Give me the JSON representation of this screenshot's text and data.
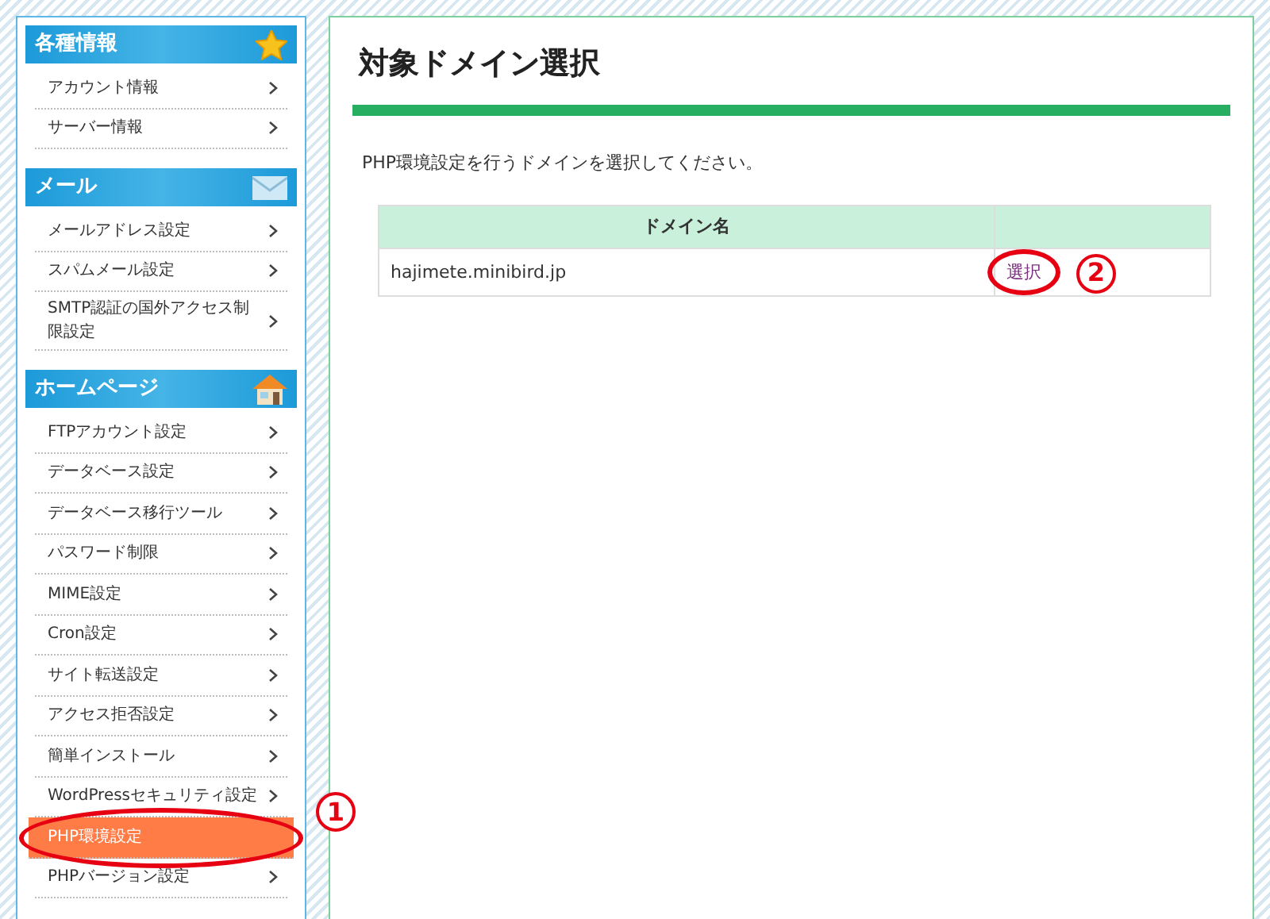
{
  "sidebar": {
    "sections": [
      {
        "title": "各種情報",
        "kind": "star",
        "items": [
          {
            "label": "アカウント情報",
            "selected": false
          },
          {
            "label": "サーバー情報",
            "selected": false
          }
        ]
      },
      {
        "title": "メール",
        "kind": "mail",
        "items": [
          {
            "label": "メールアドレス設定",
            "selected": false
          },
          {
            "label": "スパムメール設定",
            "selected": false
          },
          {
            "label": "SMTP認証の国外アクセス制限設定",
            "selected": false
          }
        ]
      },
      {
        "title": "ホームページ",
        "kind": "home",
        "items": [
          {
            "label": "FTPアカウント設定",
            "selected": false
          },
          {
            "label": "データベース設定",
            "selected": false
          },
          {
            "label": "データベース移行ツール",
            "selected": false
          },
          {
            "label": "パスワード制限",
            "selected": false
          },
          {
            "label": "MIME設定",
            "selected": false
          },
          {
            "label": "Cron設定",
            "selected": false
          },
          {
            "label": "サイト転送設定",
            "selected": false
          },
          {
            "label": "アクセス拒否設定",
            "selected": false
          },
          {
            "label": "簡単インストール",
            "selected": false
          },
          {
            "label": "WordPressセキュリティ設定",
            "selected": false
          },
          {
            "label": "PHP環境設定",
            "selected": true,
            "marker": "1"
          },
          {
            "label": "PHPバージョン設定",
            "selected": false
          }
        ]
      }
    ]
  },
  "main": {
    "title": "対象ドメイン選択",
    "description": "PHP環境設定を行うドメインを選択してください。",
    "table": {
      "columns": [
        "ドメイン名"
      ],
      "rows": [
        {
          "domain": "hajimete.minibird.jp",
          "action": "選択",
          "marker": "2"
        }
      ]
    }
  }
}
